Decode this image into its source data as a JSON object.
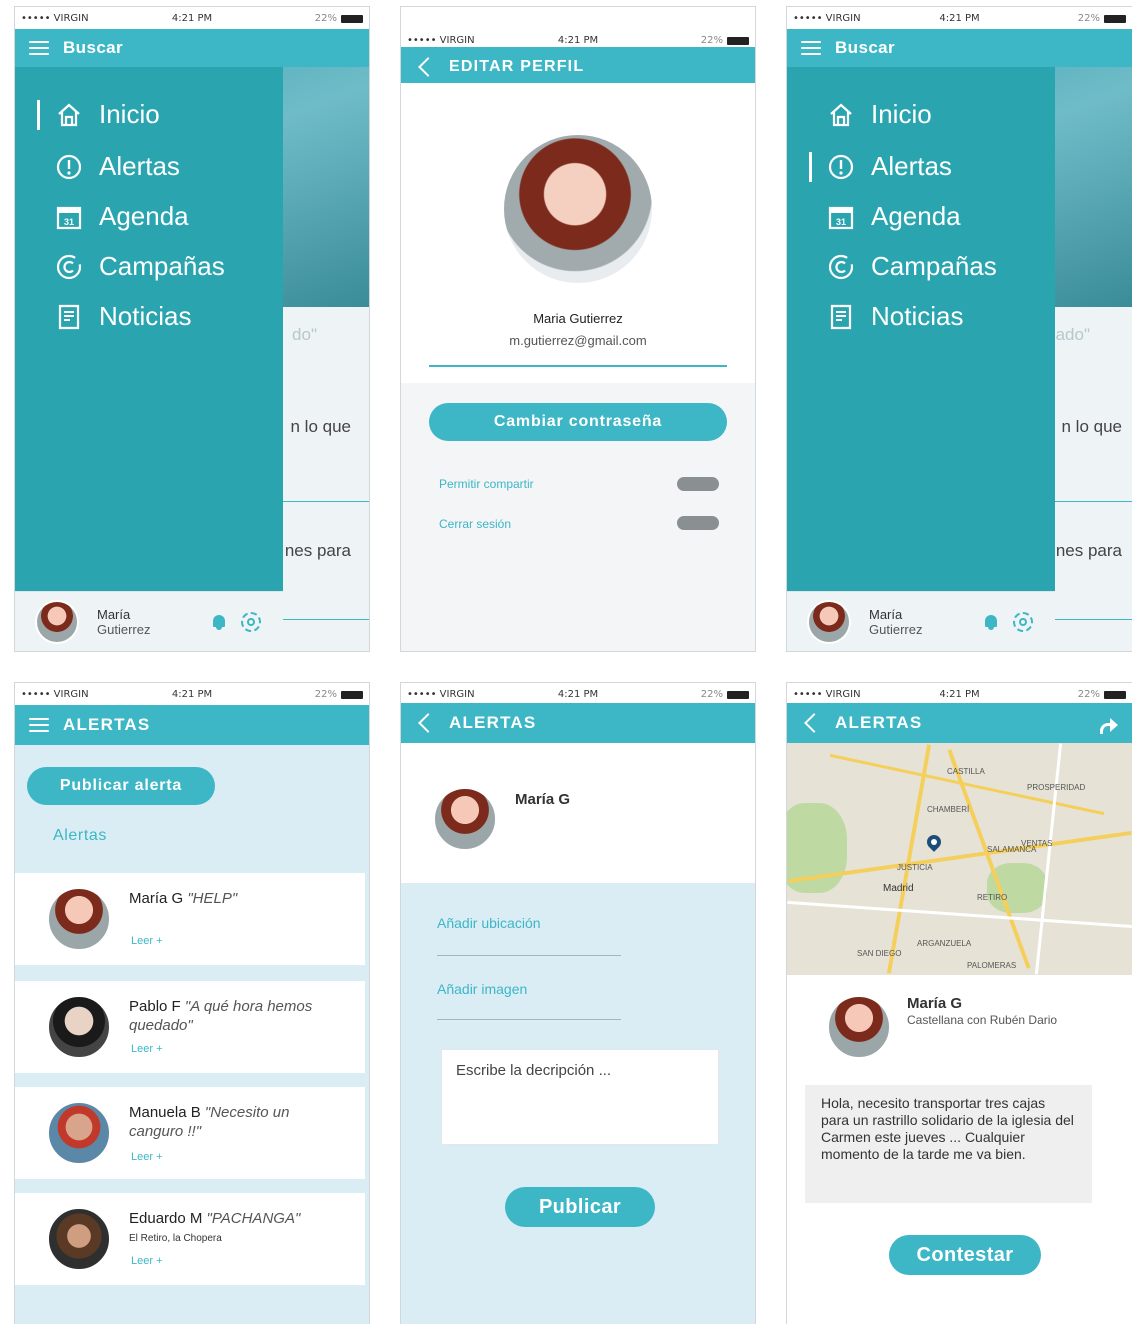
{
  "status_bar": {
    "carrier": "••••• VIRGIN",
    "time": "4:21 PM",
    "battery": "22%"
  },
  "menu": {
    "header_title": "Buscar",
    "items": [
      {
        "label": "Inicio",
        "icon": "home-icon"
      },
      {
        "label": "Alertas",
        "icon": "alert-icon"
      },
      {
        "label": "Agenda",
        "icon": "calendar-icon"
      },
      {
        "label": "Campañas",
        "icon": "campaign-icon"
      },
      {
        "label": "Noticias",
        "icon": "news-icon"
      }
    ],
    "calendar_day": "31",
    "background_fragments": [
      "do\"",
      "n lo que",
      "nes para"
    ],
    "background_fragments_right": [
      "ado\"",
      "n lo que",
      "nes para"
    ],
    "user_first": "María",
    "user_last": "Gutierrez",
    "active_left": "Inicio",
    "active_right": "Alertas"
  },
  "profile": {
    "title": "EDITAR PERFIL",
    "name": "Maria Gutierrez",
    "email": "m.gutierrez@gmail.com",
    "change_password": "Cambiar contraseña",
    "settings": [
      {
        "label": "Permitir compartir",
        "enabled": false
      },
      {
        "label": "Cerrar sesión",
        "enabled": false
      }
    ]
  },
  "alerts_list": {
    "title": "ALERTAS",
    "publish_button": "Publicar alerta",
    "section": "Alertas",
    "items": [
      {
        "author": "María G",
        "quote": "\"HELP\"",
        "subtitle": "",
        "read": "Leer +"
      },
      {
        "author": "Pablo F",
        "quote": "\"A qué hora hemos quedado\"",
        "subtitle": "",
        "read": "Leer +"
      },
      {
        "author": "Manuela B",
        "quote": "\"Necesito un canguro !!\"",
        "subtitle": "",
        "read": "Leer +"
      },
      {
        "author": "Eduardo M",
        "quote": "\"PACHANGA\"",
        "subtitle": "El Retiro, la Chopera",
        "read": "Leer +"
      }
    ]
  },
  "new_alert": {
    "title": "ALERTAS",
    "author": "María G",
    "add_location": "Añadir ubicación",
    "add_image": "Añadir imagen",
    "description_placeholder": "Escribe la decripción ...",
    "publish": "Publicar"
  },
  "alert_detail": {
    "title": "ALERTAS",
    "author": "María G",
    "location": "Castellana con Rubén Dario",
    "message": "Hola, necesito transportar tres cajas para un rastrillo solidario de la iglesia del Carmen este jueves ... Cualquier momento de la tarde me va bien.",
    "reply": "Contestar",
    "map_labels": [
      "Madrid",
      "JUSTICIA",
      "CHAMBERÍ",
      "RETIRO",
      "CASTILLA",
      "PROSPERIDAD",
      "ARGANZUELA",
      "SAN DIEGO",
      "PALOMERAS",
      "VENTAS",
      "SALAMANCA"
    ]
  },
  "colors": {
    "accent": "#3db6c6",
    "drawer": "#2aa5b0",
    "light_bg": "#daedf4"
  }
}
